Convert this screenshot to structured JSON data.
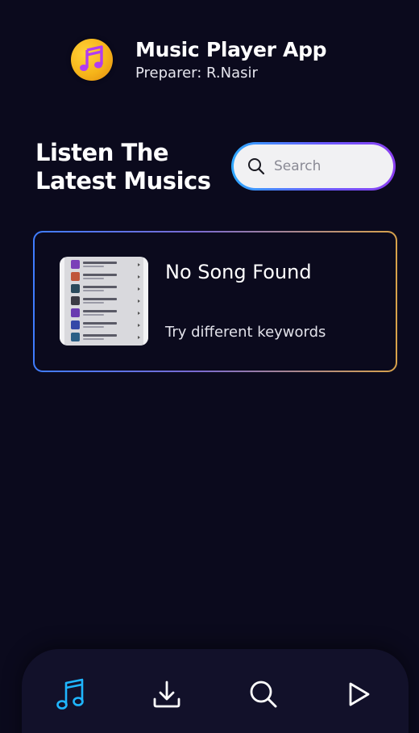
{
  "header": {
    "title": "Music Player App",
    "subtitle": "Preparer: R.Nasir",
    "logo_icon": "music-note-icon"
  },
  "hero": {
    "title": "Listen The Latest Musics"
  },
  "search": {
    "placeholder": "Search",
    "value": "",
    "icon": "search-icon"
  },
  "result_card": {
    "title": "No Song Found",
    "subtitle": "Try different keywords"
  },
  "bottom_nav": {
    "items": [
      {
        "name": "music",
        "icon": "music-note-icon",
        "active": true
      },
      {
        "name": "download",
        "icon": "download-icon",
        "active": false
      },
      {
        "name": "search",
        "icon": "search-icon",
        "active": false
      },
      {
        "name": "play",
        "icon": "play-icon",
        "active": false
      }
    ]
  },
  "colors": {
    "background": "#0b0a1d",
    "nav_background": "#12112a",
    "active_icon": "#1fb6ff",
    "inactive_icon": "#ffffff",
    "logo_yellow": "#f6b419",
    "logo_note": "#b23cf0"
  }
}
